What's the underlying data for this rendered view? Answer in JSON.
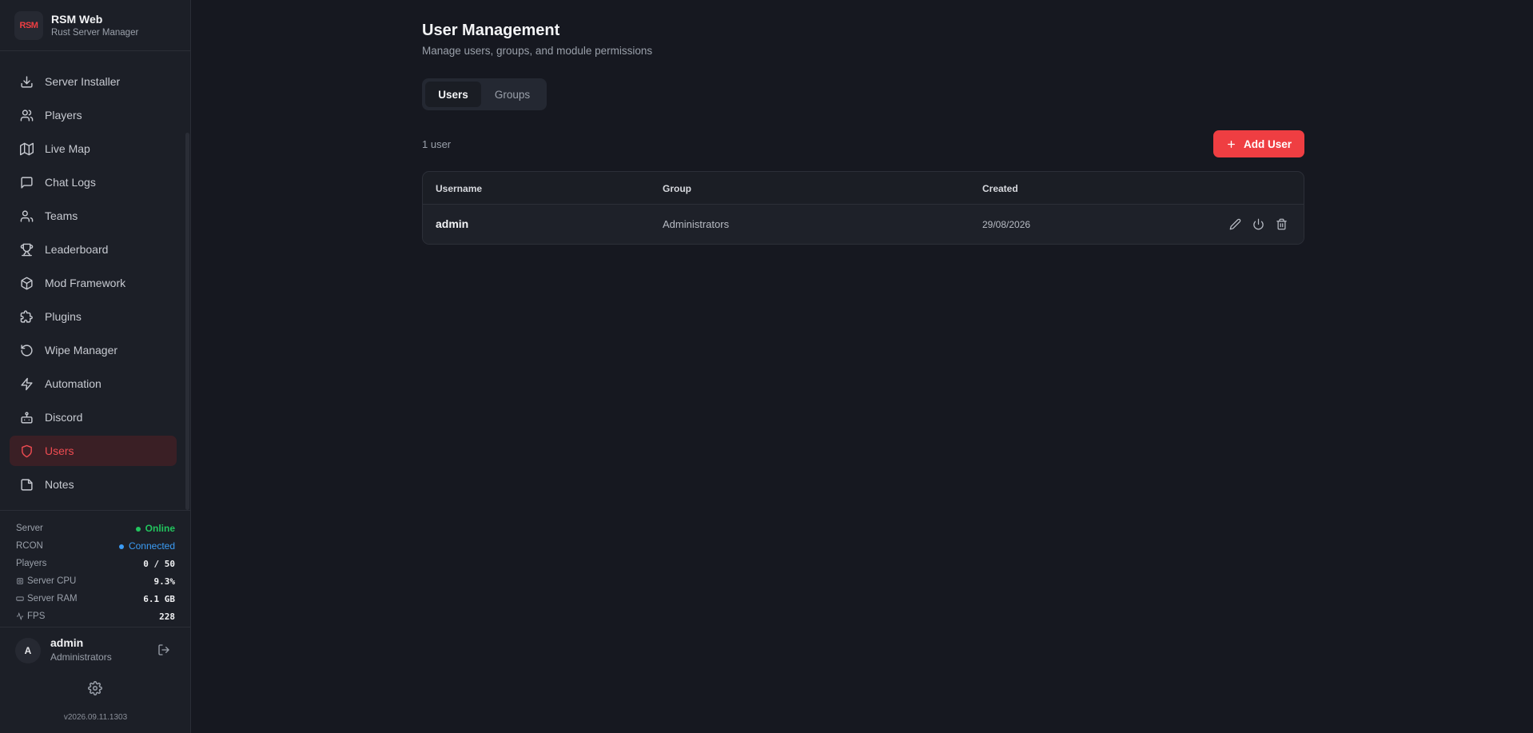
{
  "brand": {
    "logo_text": "RSM",
    "title": "RSM Web",
    "subtitle": "Rust Server Manager"
  },
  "sidebar": {
    "items": [
      {
        "label": "Server Installer",
        "icon": "download-icon"
      },
      {
        "label": "Players",
        "icon": "users-icon"
      },
      {
        "label": "Live Map",
        "icon": "map-icon"
      },
      {
        "label": "Chat Logs",
        "icon": "chat-icon"
      },
      {
        "label": "Teams",
        "icon": "users-icon"
      },
      {
        "label": "Leaderboard",
        "icon": "trophy-icon"
      },
      {
        "label": "Mod Framework",
        "icon": "package-icon"
      },
      {
        "label": "Plugins",
        "icon": "puzzle-icon"
      },
      {
        "label": "Wipe Manager",
        "icon": "rotate-icon"
      },
      {
        "label": "Automation",
        "icon": "lightning-icon"
      },
      {
        "label": "Discord",
        "icon": "bot-icon"
      },
      {
        "label": "Users",
        "icon": "shield-icon",
        "active": true
      },
      {
        "label": "Notes",
        "icon": "note-icon"
      }
    ]
  },
  "status": {
    "server": {
      "label": "Server",
      "value": "Online",
      "color": "#22c55e"
    },
    "rcon": {
      "label": "RCON",
      "value": "Connected",
      "color": "#3b9cf5"
    },
    "players": {
      "label": "Players",
      "value": "0 / 50"
    },
    "cpu": {
      "label": "Server CPU",
      "value": "9.3%"
    },
    "ram": {
      "label": "Server RAM",
      "value": "6.1 GB"
    },
    "fps": {
      "label": "FPS",
      "value": "228"
    }
  },
  "current_user": {
    "initial": "A",
    "name": "admin",
    "group": "Administrators"
  },
  "version": "v2026.09.11.1303",
  "main": {
    "title": "User Management",
    "subtitle": "Manage users, groups, and module permissions",
    "tabs": [
      {
        "label": "Users",
        "active": true
      },
      {
        "label": "Groups",
        "active": false
      }
    ],
    "count_label": "1 user",
    "add_button": "Add User",
    "table": {
      "columns": [
        "Username",
        "Group",
        "Created"
      ],
      "rows": [
        {
          "username": "admin",
          "group": "Administrators",
          "created": "29/08/2026"
        }
      ]
    }
  },
  "colors": {
    "accent": "#ef3e42",
    "background": "#161820",
    "sidebar": "#1c1f27"
  }
}
